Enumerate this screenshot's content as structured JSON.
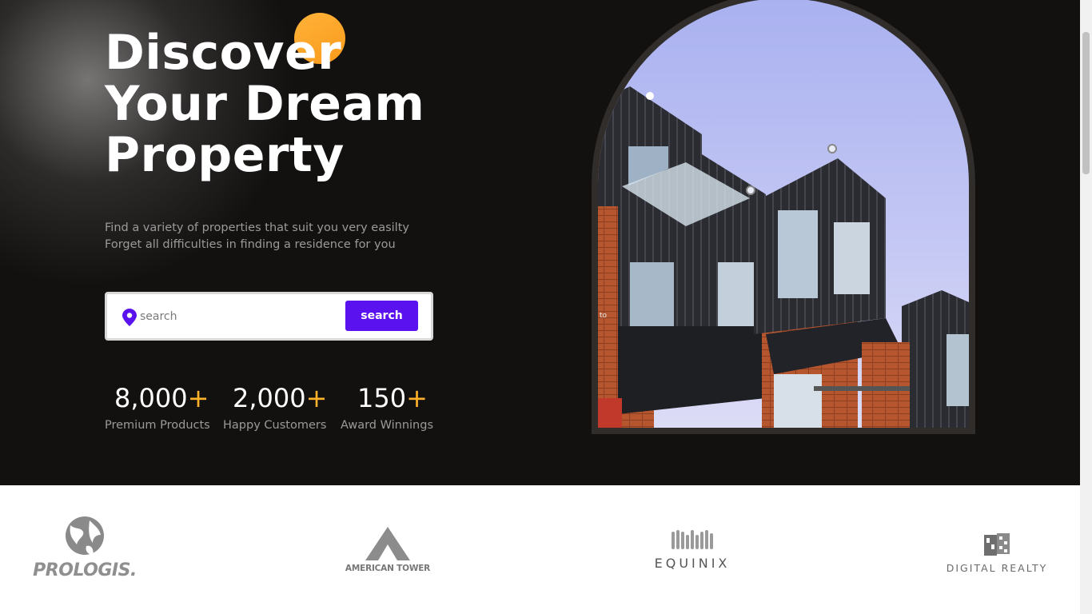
{
  "hero": {
    "title_lines": [
      "Discover",
      "Your Dream",
      "Property"
    ],
    "subtitle_lines": [
      "Find a variety of properties that suit you very easilty",
      "Forget all difficulties in finding a residence for you"
    ],
    "accent_color": "#ffb32b",
    "brand_color": "#5a12ee"
  },
  "search": {
    "placeholder": "search",
    "value": "",
    "button_label": "search",
    "icon": "location-pin-icon"
  },
  "stats": [
    {
      "value": "8,000",
      "suffix": "+",
      "label": "Premium Products"
    },
    {
      "value": "2,000",
      "suffix": "+",
      "label": "Happy Customers"
    },
    {
      "value": "150",
      "suffix": "+",
      "label": "Award Winnings"
    }
  ],
  "hero_image": {
    "overlay_text": "to"
  },
  "partners": [
    {
      "name": "PROLOGIS",
      "suffix": "."
    },
    {
      "name": "AMERICAN TOWER"
    },
    {
      "name": "EQUINIX"
    },
    {
      "name": "DIGITAL REALTY"
    }
  ]
}
